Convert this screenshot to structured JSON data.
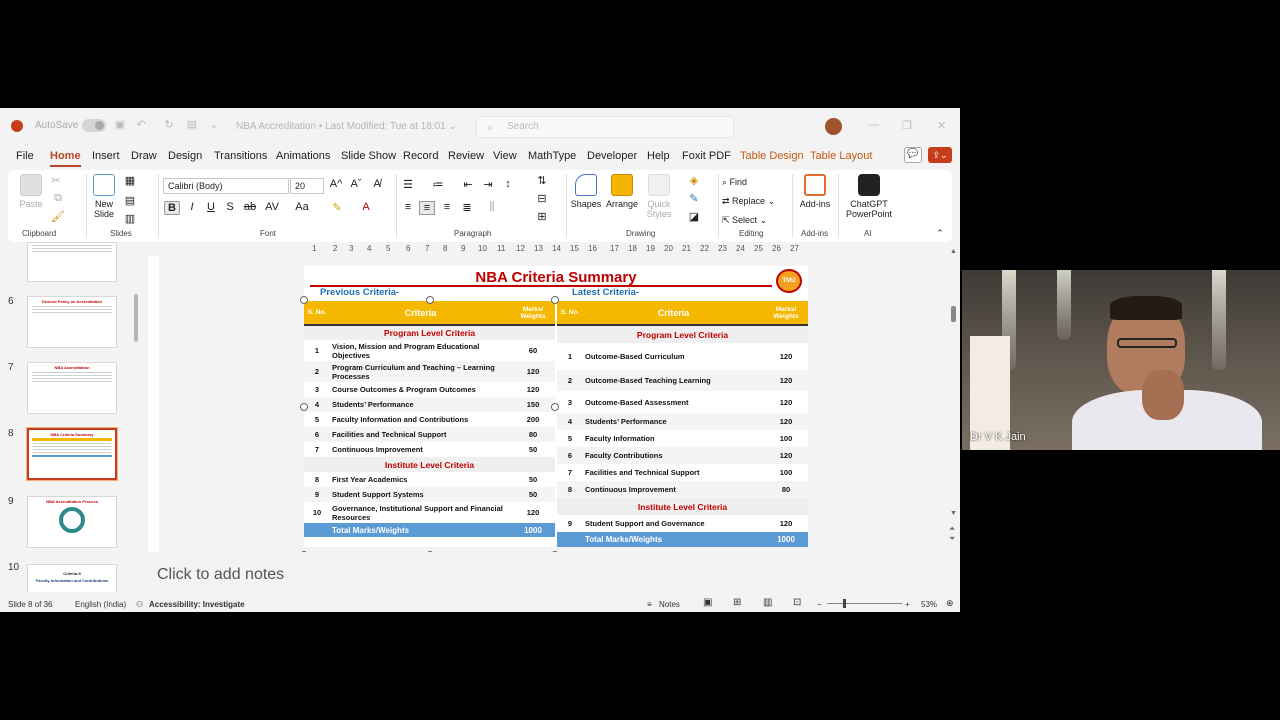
{
  "titlebar": {
    "autosave": "AutoSave",
    "doc_title": "NBA Accreditation • Last Modified: Tue at 18:01 ⌄",
    "search_placeholder": "Search"
  },
  "tabs": [
    "File",
    "Home",
    "Insert",
    "Draw",
    "Design",
    "Transitions",
    "Animations",
    "Slide Show",
    "Record",
    "Review",
    "View",
    "MathType",
    "Developer",
    "Help",
    "Foxit PDF",
    "Table Design",
    "Table Layout"
  ],
  "ribbon": {
    "clipboard": {
      "paste": "Paste",
      "label": "Clipboard"
    },
    "slides": {
      "new_slide": "New Slide",
      "label": "Slides"
    },
    "font": {
      "name": "Calibri (Body)",
      "size": "20",
      "label": "Font"
    },
    "paragraph": {
      "label": "Paragraph"
    },
    "drawing": {
      "shapes": "Shapes",
      "arrange": "Arrange",
      "quick_styles": "Quick Styles",
      "label": "Drawing"
    },
    "editing": {
      "find": "Find",
      "replace": "Replace",
      "select": "Select",
      "label": "Editing"
    },
    "addins": {
      "addins": "Add-ins",
      "label": "Add-ins"
    },
    "ai": {
      "chatgpt": "ChatGPT PowerPoint",
      "label": "AI"
    }
  },
  "thumbnails": [
    {
      "num": "6",
      "title": "Desired Policy on Accreditation"
    },
    {
      "num": "7",
      "title": "NBA Accreditation"
    },
    {
      "num": "8",
      "title": "NBA Criteria Summary"
    },
    {
      "num": "9",
      "title": "NBA Accreditation Process"
    },
    {
      "num": "10",
      "title": "Criteria-5",
      "subtitle": "Faculty Information and Contributions"
    }
  ],
  "slide": {
    "title": "NBA Criteria Summary",
    "logo": "TMU",
    "previous_label": "Previous Criteria-",
    "latest_label": "Latest Criteria-",
    "header": {
      "sno": "S. No.",
      "criteria": "Criteria",
      "marks": "Marks/ Weights"
    },
    "previous": {
      "program_heading": "Program Level Criteria",
      "program_rows": [
        {
          "n": "1",
          "c": "Vision, Mission and Program Educational Objectives",
          "m": "60"
        },
        {
          "n": "2",
          "c": "Program Curriculum and Teaching – Learning Processes",
          "m": "120"
        },
        {
          "n": "3",
          "c": "Course Outcomes & Program Outcomes",
          "m": "120"
        },
        {
          "n": "4",
          "c": "Students’ Performance",
          "m": "150"
        },
        {
          "n": "5",
          "c": "Faculty Information and Contributions",
          "m": "200"
        },
        {
          "n": "6",
          "c": "Facilities and Technical Support",
          "m": "80"
        },
        {
          "n": "7",
          "c": "Continuous Improvement",
          "m": "50"
        }
      ],
      "institute_heading": "Institute Level Criteria",
      "institute_rows": [
        {
          "n": "8",
          "c": "First Year Academics",
          "m": "50"
        },
        {
          "n": "9",
          "c": "Student Support Systems",
          "m": "50"
        },
        {
          "n": "10",
          "c": "Governance, Institutional Support and Financial Resources",
          "m": "120"
        }
      ],
      "total_label": "Total Marks/Weights",
      "total": "1000"
    },
    "latest": {
      "program_heading": "Program Level Criteria",
      "program_rows": [
        {
          "n": "1",
          "c": "Outcome-Based Curriculum",
          "m": "120"
        },
        {
          "n": "2",
          "c": "Outcome-Based Teaching Learning",
          "m": "120"
        },
        {
          "n": "3",
          "c": "Outcome-Based Assessment",
          "m": "120"
        },
        {
          "n": "4",
          "c": "Students’ Performance",
          "m": "120"
        },
        {
          "n": "5",
          "c": "Faculty Information",
          "m": "100"
        },
        {
          "n": "6",
          "c": "Faculty Contributions",
          "m": "120"
        },
        {
          "n": "7",
          "c": "Facilities and Technical Support",
          "m": "100"
        },
        {
          "n": "8",
          "c": "Continuous Improvement",
          "m": "80"
        }
      ],
      "institute_heading": "Institute Level Criteria",
      "institute_rows": [
        {
          "n": "9",
          "c": "Student Support and Governance",
          "m": "120"
        }
      ],
      "total_label": "Total Marks/Weights",
      "total": "1000"
    }
  },
  "notes_placeholder": "Click to add notes",
  "statusbar": {
    "slide": "Slide 8 of 36",
    "language": "English (India)",
    "accessibility": "Accessibility: Investigate",
    "notes": "Notes",
    "zoom": "53%"
  },
  "video": {
    "participant": "Dr V K Jain"
  }
}
